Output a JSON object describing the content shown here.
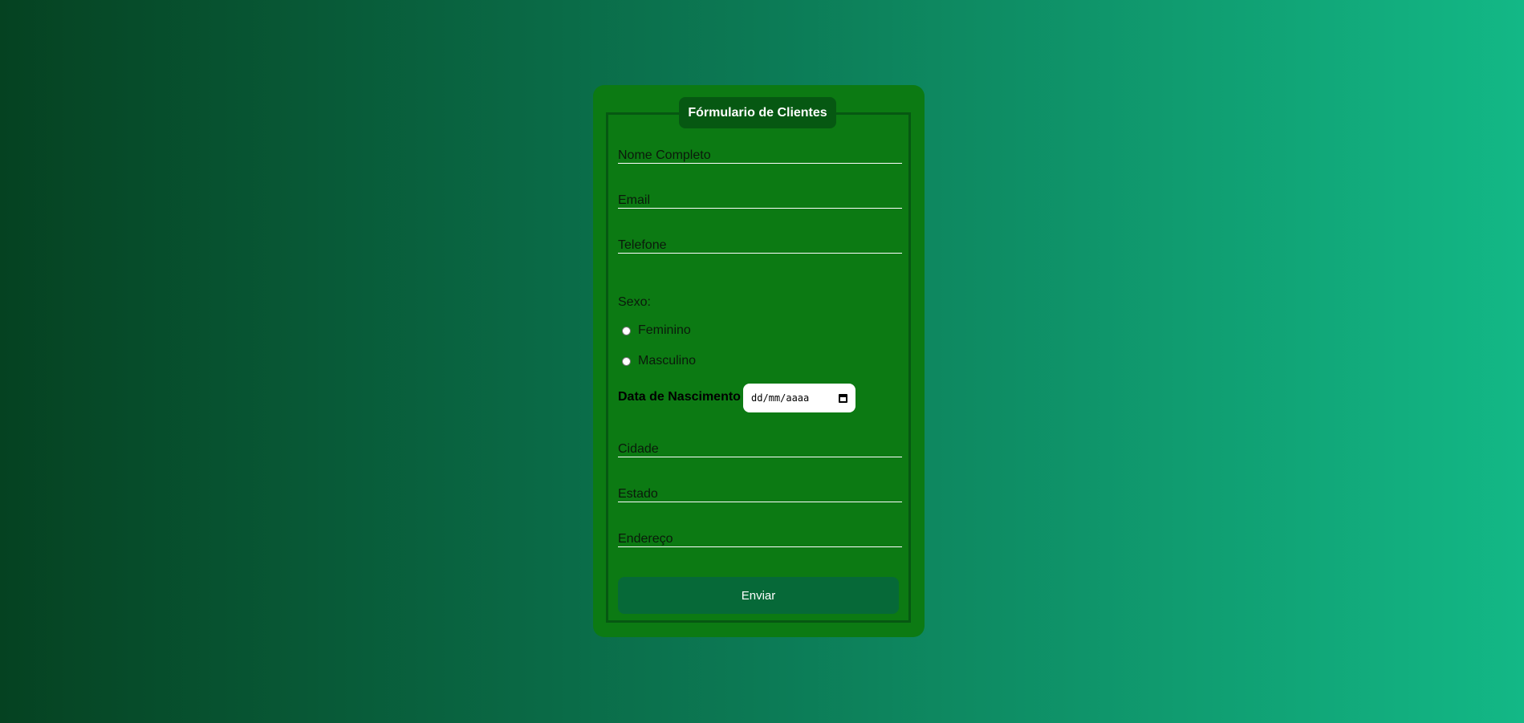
{
  "form": {
    "legend": "Fórmulario de Clientes",
    "fields": {
      "nome": "Nome Completo",
      "email": "Email",
      "telefone": "Telefone",
      "cidade": "Cidade",
      "estado": "Estado",
      "endereco": "Endereço"
    },
    "sexo": {
      "label": "Sexo:",
      "options": [
        "Feminino",
        "Masculino"
      ]
    },
    "nascimento": {
      "label": "Data de Nascimento",
      "placeholder": "dd/mm/aaaa"
    },
    "submit_label": "Enviar"
  },
  "colors": {
    "card": "#0c7a13",
    "legend_bg": "#065812",
    "button_bg": "#066938"
  }
}
